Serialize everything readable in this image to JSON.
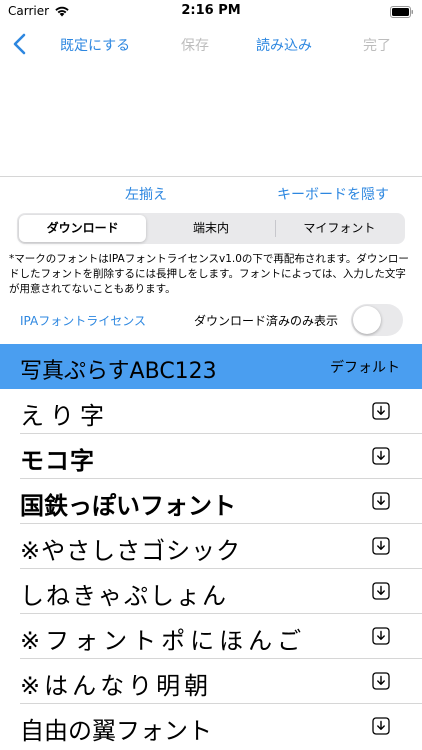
{
  "status_bar": {
    "carrier": "Carrier",
    "time": "2:16 PM"
  },
  "nav": {
    "set_default": "既定にする",
    "save": "保存",
    "load": "読み込み",
    "done": "完了"
  },
  "actions": {
    "align_left": "左揃え",
    "hide_keyboard": "キーボードを隠す"
  },
  "segments": [
    "ダウンロード",
    "端末内",
    "マイフォント"
  ],
  "selected_segment": "ダウンロード",
  "notice": "*マークのフォントはIPAフォントライセンスv1.0の下で再配布されます。ダウンロードしたフォントを削除するには長押しをします。フォントによっては、入力した文字が用意されてないこともあります。",
  "license_link": "IPAフォントライセンス",
  "toggle": {
    "label": "ダウンロード済みのみ表示",
    "on": false
  },
  "selected_font": {
    "name": "写真ぷらすABC123",
    "tag": "デフォルト"
  },
  "fonts": [
    {
      "name": "えり字",
      "icon": "download-icon"
    },
    {
      "name": "モコ字",
      "icon": "download-icon"
    },
    {
      "name": "国鉄っぽいフォント",
      "icon": "download-icon"
    },
    {
      "name": "※やさしさゴシック",
      "icon": "download-icon"
    },
    {
      "name": "しねきゃぷしょん",
      "icon": "download-icon"
    },
    {
      "name": "※フォントポにほんご",
      "icon": "download-icon"
    },
    {
      "name": "※はんなり明朝",
      "icon": "download-icon"
    },
    {
      "name": "自由の翼フォント",
      "icon": "download-icon"
    }
  ],
  "colors": {
    "accent": "#2d87e0",
    "selected_row": "#4a9ef0",
    "disabled": "#bdbdbd"
  }
}
